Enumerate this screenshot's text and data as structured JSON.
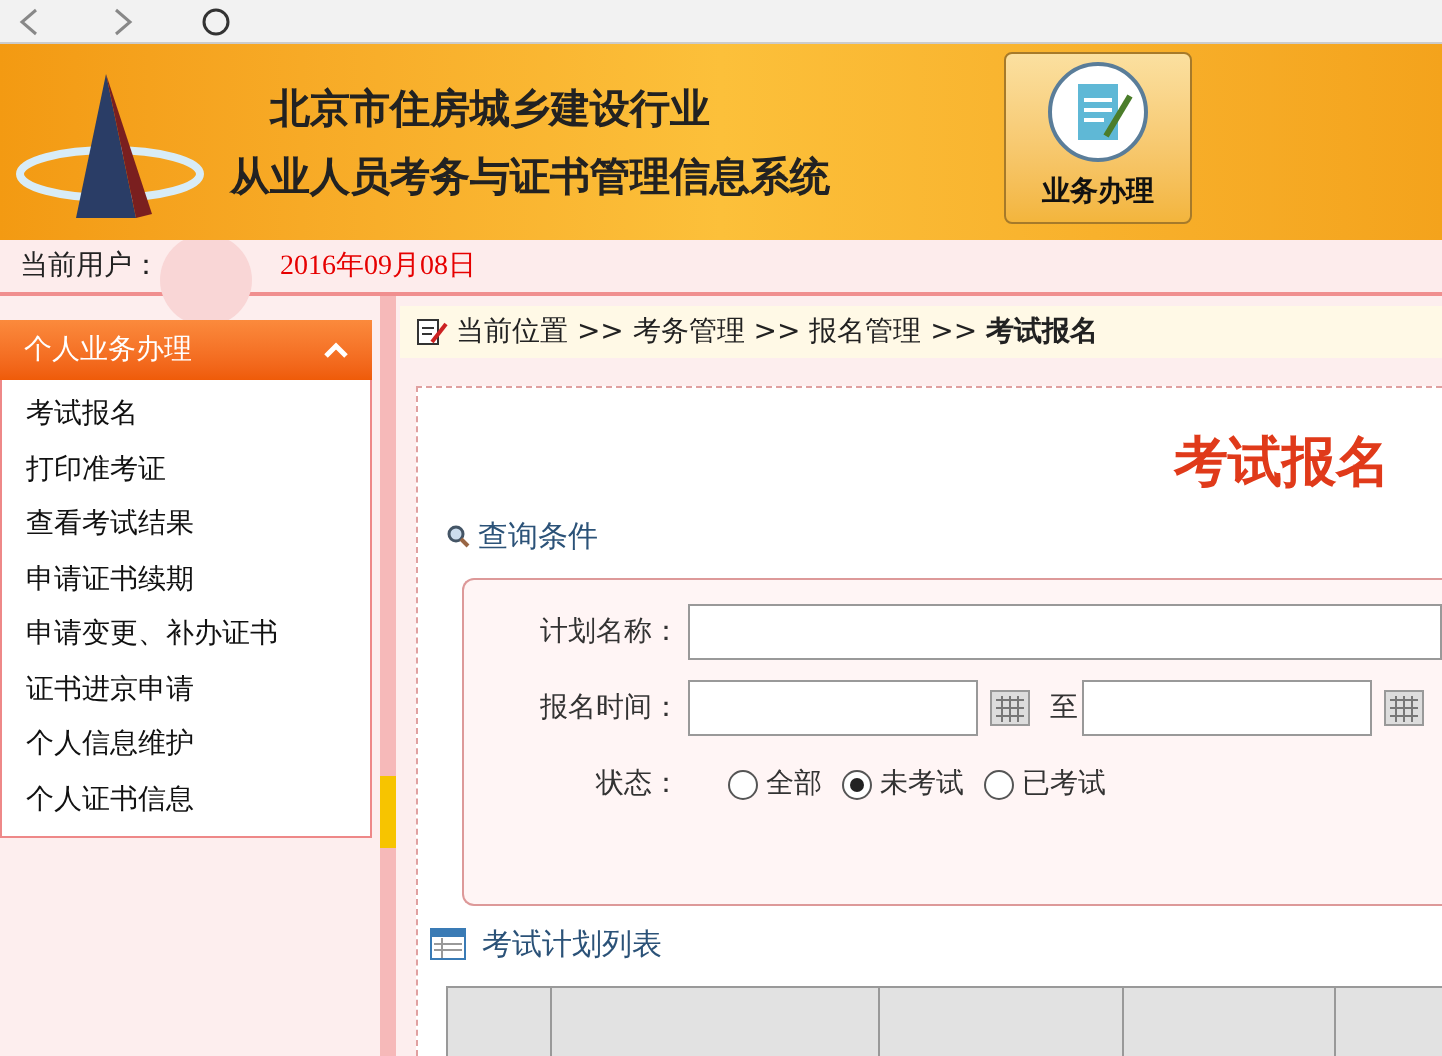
{
  "header": {
    "title_line_1": "北京市住房城乡建设行业",
    "title_line_2": "从业人员考务与证书管理信息系统",
    "action_button": "业务办理"
  },
  "user_bar": {
    "label": "当前用户：",
    "date": "2016年09月08日"
  },
  "sidebar": {
    "title": "个人业务办理",
    "expanded": true,
    "items": [
      {
        "label": "考试报名"
      },
      {
        "label": "打印准考证"
      },
      {
        "label": "查看考试结果"
      },
      {
        "label": "申请证书续期"
      },
      {
        "label": "申请变更、补办证书"
      },
      {
        "label": "证书进京申请"
      },
      {
        "label": "个人信息维护"
      },
      {
        "label": "个人证书信息"
      }
    ]
  },
  "breadcrumb": {
    "path": "当前位置 >> 考务管理 >> 报名管理 >> ",
    "current": "考试报名"
  },
  "page_title": "考试报名",
  "query": {
    "title": "查询条件",
    "plan_name_label": "计划名称：",
    "time_label": "报名时间：",
    "to_label": "至",
    "status_label": "状态：",
    "status_options": [
      {
        "label": "全部",
        "selected": false
      },
      {
        "label": "未考试",
        "selected": true
      },
      {
        "label": "已考试",
        "selected": false
      }
    ]
  },
  "list_title": "考试计划列表",
  "table": {
    "columns": [
      {},
      {},
      {},
      {},
      {}
    ]
  }
}
